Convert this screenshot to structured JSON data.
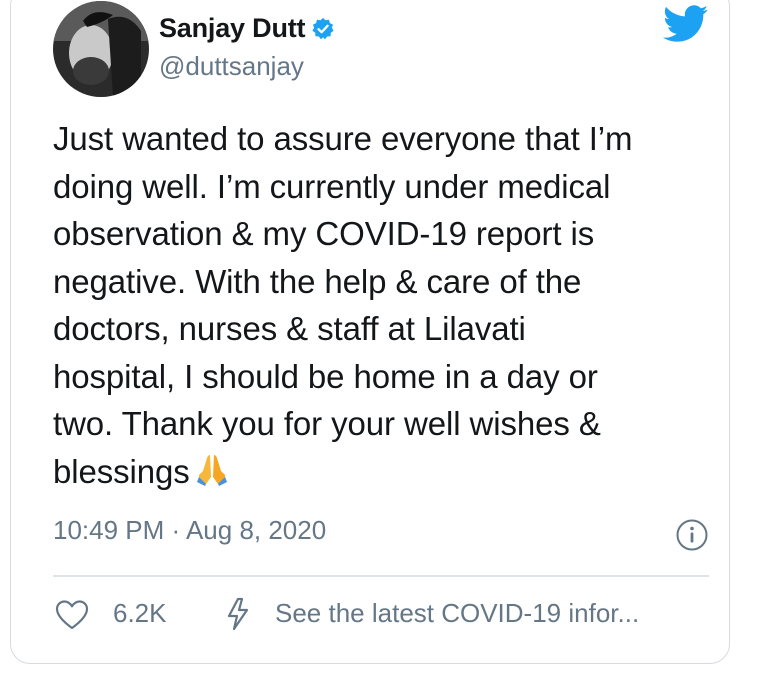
{
  "tweet": {
    "author": {
      "name": "Sanjay Dutt",
      "handle": "@duttsanjay",
      "verified": true
    },
    "text": "Just wanted to assure everyone that I’m\ndoing well. I’m currently under medical\nobservation & my COVID-19 report is\nnegative. With the help & care of the\ndoctors, nurses & staff at Lilavati\nhospital, I should be home in a day or\ntwo. Thank you for your well wishes &\nblessings",
    "emoji": "folded-hands-emoji",
    "timestamp": "10:49 PM · Aug 8, 2020",
    "likes": "6.2K",
    "covid_link": "See the latest COVID-19 infor..."
  },
  "colors": {
    "twitter_blue": "#1da1f2",
    "text": "#14171a",
    "secondary": "#657786",
    "border": "#d5dbe0"
  },
  "icons": [
    "twitter-bird-icon",
    "verified-badge-icon",
    "info-icon",
    "heart-icon",
    "lightning-icon"
  ]
}
